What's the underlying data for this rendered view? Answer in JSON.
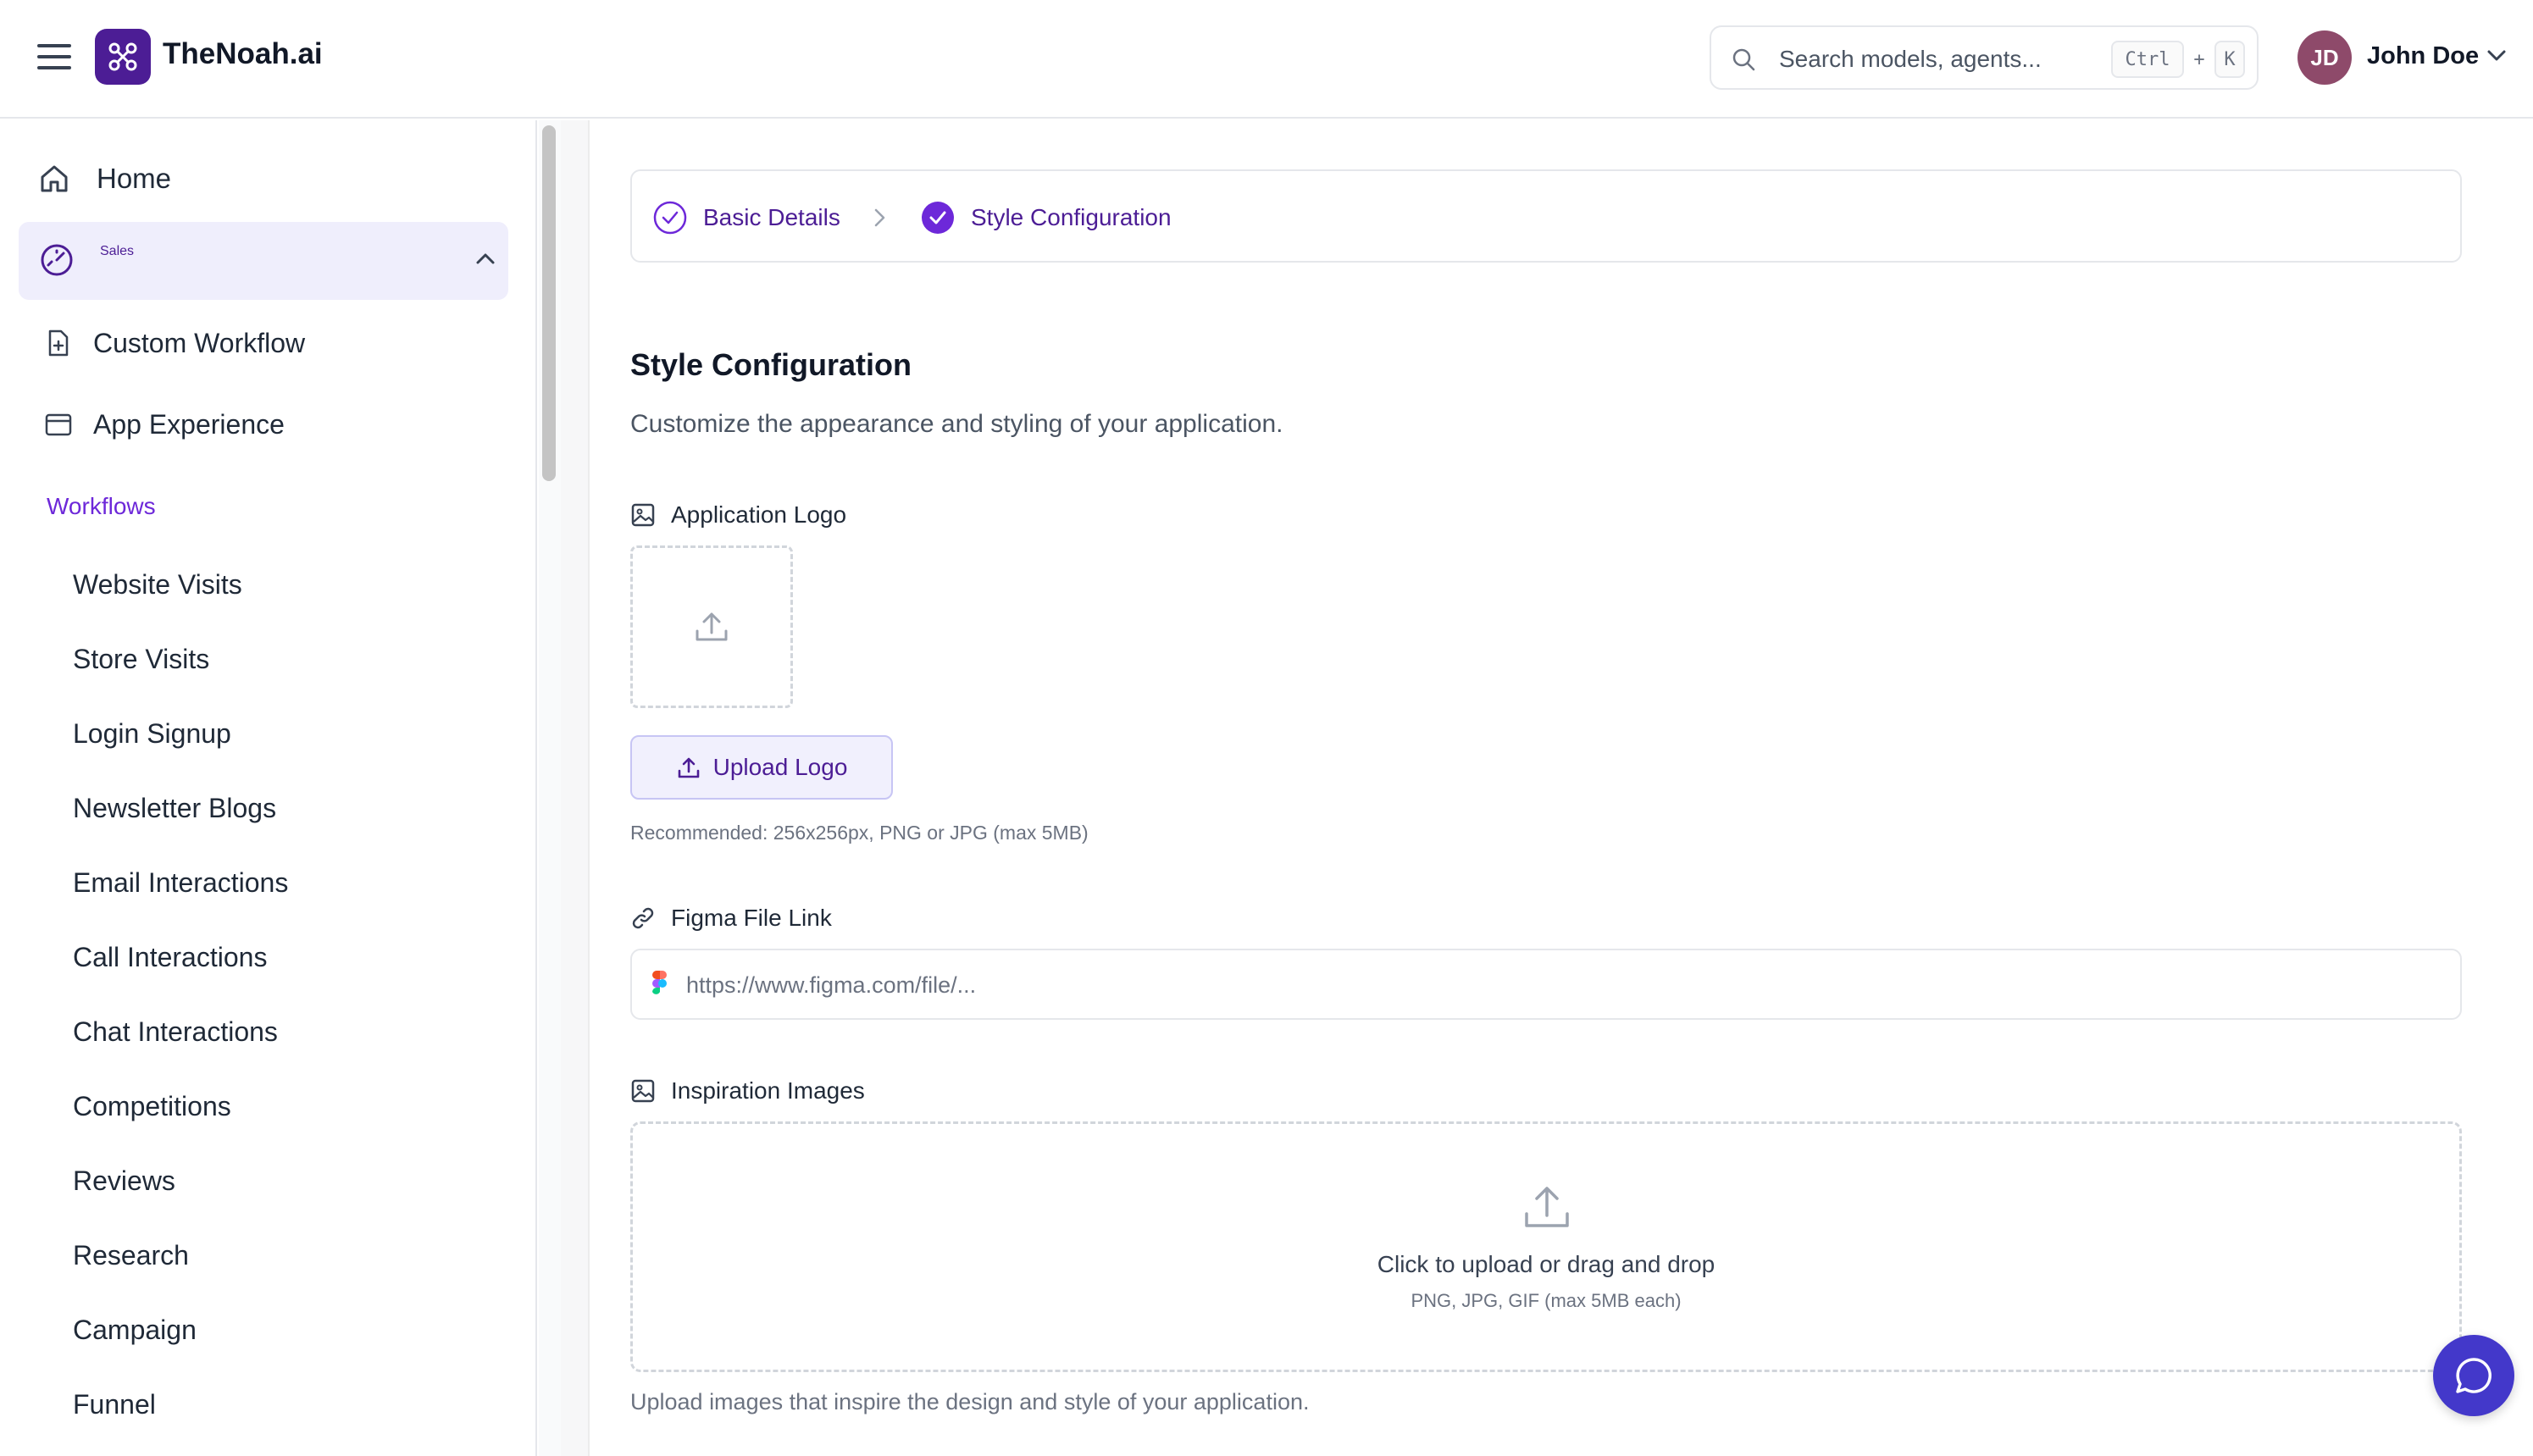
{
  "header": {
    "brand": "TheNoah.ai",
    "search_placeholder": "Search models, agents...",
    "shortcut_ctrl": "Ctrl",
    "shortcut_plus": "+",
    "shortcut_key": "K",
    "user_initials": "JD",
    "user_name": "John Doe"
  },
  "sidebar": {
    "home": "Home",
    "sales": "Sales",
    "sales_children": [
      "Custom Workflow",
      "App Experience"
    ],
    "section_label": "Workflows",
    "workflows": [
      "Website Visits",
      "Store Visits",
      "Login Signup",
      "Newsletter Blogs",
      "Email Interactions",
      "Call Interactions",
      "Chat Interactions",
      "Competitions",
      "Reviews",
      "Research",
      "Campaign",
      "Funnel"
    ]
  },
  "stepper": {
    "steps": [
      "Basic Details",
      "Style Configuration"
    ]
  },
  "main": {
    "title": "Style Configuration",
    "subtitle": "Customize the appearance and styling of your application.",
    "logo_label": "Application Logo",
    "upload_button": "Upload Logo",
    "logo_hint": "Recommended: 256x256px, PNG or JPG (max 5MB)",
    "figma_label": "Figma File Link",
    "figma_placeholder": "https://www.figma.com/file/...",
    "figma_value": "",
    "images_label": "Inspiration Images",
    "images_drop_text": "Click to upload or drag and drop",
    "images_drop_sub": "PNG, JPG, GIF (max 5MB each)",
    "images_hint": "Upload images that inspire the design and style of your application."
  },
  "colors": {
    "accent": "#4c1d95",
    "accent_bright": "#6d28d9",
    "sales_bg": "#efeefc",
    "fab": "#4338ca",
    "avatar": "#8e4a6a"
  },
  "icons": {
    "menu": "hamburger-icon",
    "logo": "network-logo-icon",
    "search": "search-icon",
    "chevron": "chevron-down-icon",
    "home": "home-icon",
    "sales": "gauge-icon",
    "custom_workflow": "file-plus-icon",
    "app_experience": "browser-window-icon",
    "step_done": "check-circle-icon",
    "separator": "chevron-right-icon",
    "image": "image-icon",
    "upload": "upload-icon",
    "link": "link-icon",
    "figma": "figma-icon",
    "chat": "chat-bubble-icon"
  }
}
